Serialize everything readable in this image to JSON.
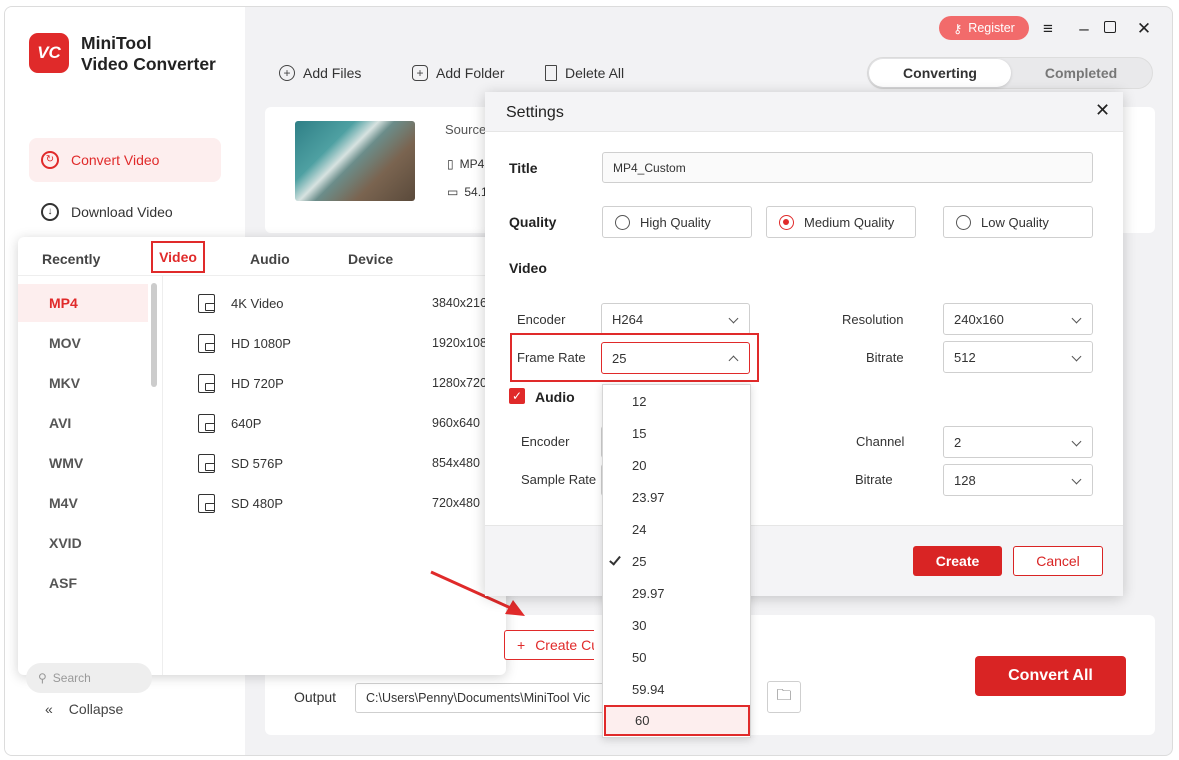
{
  "app": {
    "name_line1": "MiniTool",
    "name_line2": "Video Converter",
    "logo_text": "VC"
  },
  "colors": {
    "accent": "#e02a2a",
    "register": "#f26b6b",
    "active_bg": "#fdeeee"
  },
  "header": {
    "register_label": "Register",
    "window_controls": [
      "menu-icon",
      "minimize-icon",
      "maximize-icon",
      "close-icon"
    ]
  },
  "sidebar": {
    "items": [
      {
        "label": "Convert Video",
        "icon": "convert-icon",
        "active": true
      },
      {
        "label": "Download Video",
        "icon": "download-icon",
        "active": false
      }
    ],
    "collapse_label": "Collapse"
  },
  "toolbar": {
    "add_files": "Add Files",
    "add_folder": "Add Folder",
    "delete_all": "Delete All"
  },
  "tabs": {
    "converting": "Converting",
    "completed": "Completed",
    "active": "Converting"
  },
  "file_card": {
    "source_label": "Source",
    "format_partial": "MP4",
    "size_partial": "54.1"
  },
  "format_panel": {
    "tabs": [
      "Recently",
      "Video",
      "Audio",
      "Device"
    ],
    "active_tab": "Video",
    "formats": [
      "MP4",
      "MOV",
      "MKV",
      "AVI",
      "WMV",
      "M4V",
      "XVID",
      "ASF"
    ],
    "active_format": "MP4",
    "presets": [
      {
        "name": "4K Video",
        "resolution": "3840x216"
      },
      {
        "name": "HD 1080P",
        "resolution": "1920x108"
      },
      {
        "name": "HD 720P",
        "resolution": "1280x720"
      },
      {
        "name": "640P",
        "resolution": "960x640"
      },
      {
        "name": "SD 576P",
        "resolution": "854x480"
      },
      {
        "name": "SD 480P",
        "resolution": "720x480"
      }
    ],
    "search_placeholder": "Search",
    "create_custom_label": "Create Cus"
  },
  "settings": {
    "title": "Settings",
    "title_label": "Title",
    "title_value": "MP4_Custom",
    "quality_label": "Quality",
    "quality_options": [
      "High Quality",
      "Medium Quality",
      "Low Quality"
    ],
    "quality_selected": "Medium Quality",
    "video_label": "Video",
    "video_encoder_label": "Encoder",
    "video_encoder_value": "H264",
    "frame_rate_label": "Frame Rate",
    "frame_rate_value": "25",
    "resolution_label": "Resolution",
    "resolution_value": "240x160",
    "video_bitrate_label": "Bitrate",
    "video_bitrate_value": "512",
    "audio_label": "Audio",
    "audio_checked": true,
    "audio_encoder_label": "Encoder",
    "sample_rate_label": "Sample Rate",
    "channel_label": "Channel",
    "channel_value": "2",
    "audio_bitrate_label": "Bitrate",
    "audio_bitrate_value": "128",
    "create_label": "Create",
    "cancel_label": "Cancel"
  },
  "frame_rate_options": [
    "12",
    "15",
    "20",
    "23.97",
    "24",
    "25",
    "29.97",
    "30",
    "50",
    "59.94",
    "60"
  ],
  "frame_rate_checked": "25",
  "frame_rate_highlighted": "60",
  "output": {
    "label": "Output",
    "path": "C:\\Users\\Penny\\Documents\\MiniTool Vic"
  },
  "convert_all_label": "Convert All"
}
